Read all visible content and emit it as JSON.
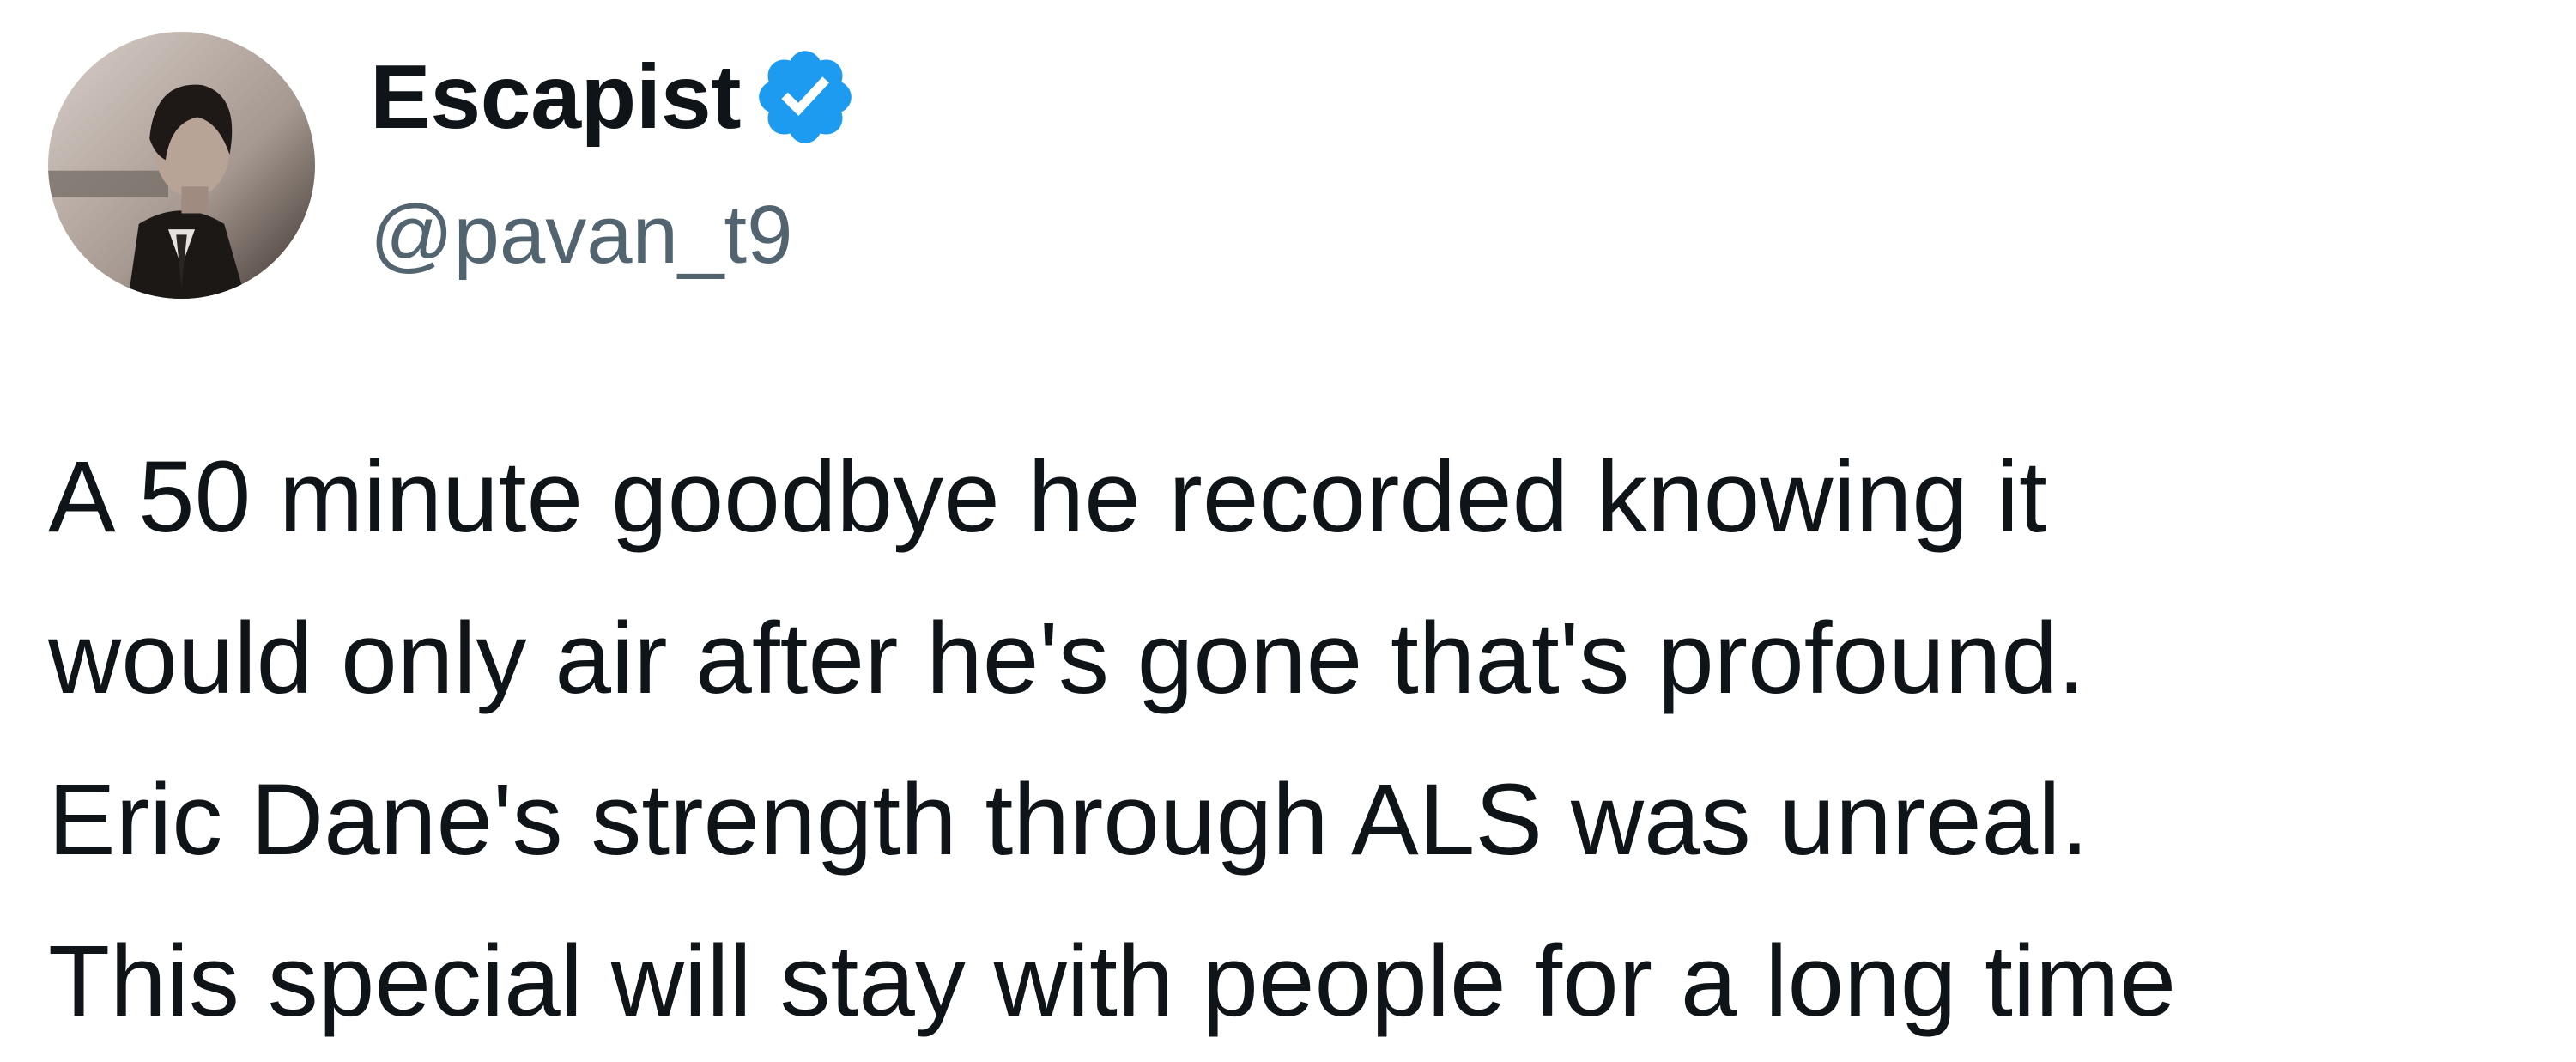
{
  "author": {
    "display_name": "Escapist",
    "handle": "@pavan_t9",
    "verified": true,
    "avatar_icon": "profile-photo-avatar",
    "badge_icon": "verified-check-icon",
    "badge_color": "#1d9bf0"
  },
  "tweet": {
    "lines": [
      "A 50 minute goodbye he recorded knowing it",
      "would only air after he's gone that's profound.",
      "Eric Dane's strength through ALS was unreal.",
      "This special will stay with people for a long time"
    ]
  },
  "colors": {
    "text_primary": "#0f1419",
    "text_secondary": "#536471",
    "background": "#ffffff"
  }
}
